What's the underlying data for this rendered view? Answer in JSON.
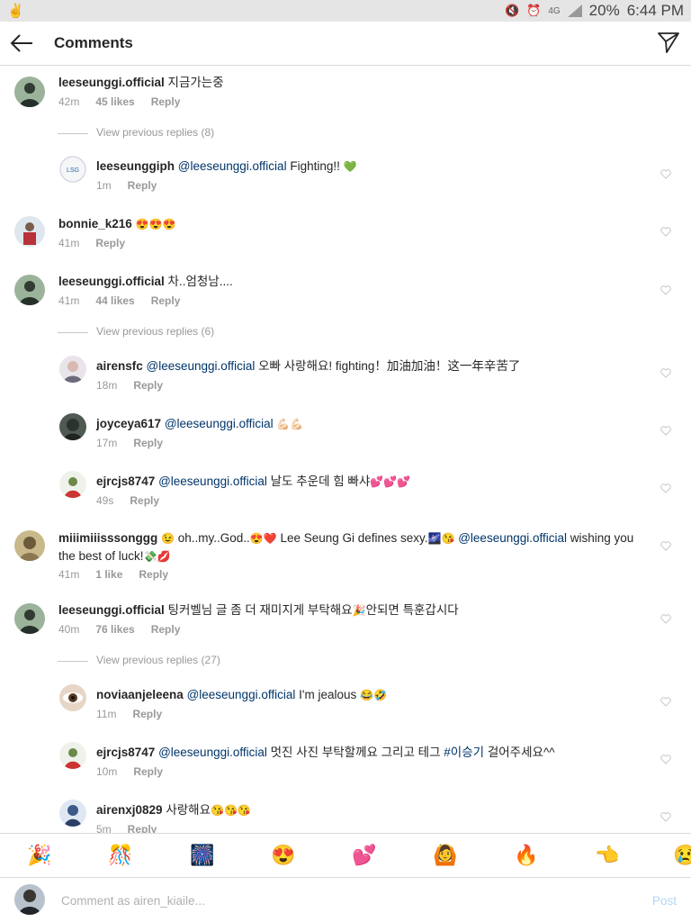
{
  "status": {
    "battery": "20%",
    "time": "6:44 PM",
    "network": "4G"
  },
  "header": {
    "title": "Comments"
  },
  "labels": {
    "reply": "Reply"
  },
  "comments": [
    {
      "user": "leeseunggi.official",
      "text": "지금가는중",
      "time": "42m",
      "likes": "45 likes"
    },
    {
      "view_prev": "View previous replies (8)"
    },
    {
      "user": "leeseunggiph",
      "mention": "@leeseunggi.official",
      "text": "Fighting!!",
      "emoji": "💚",
      "time": "1m"
    },
    {
      "user": "bonnie_k216",
      "emoji": "😍😍😍",
      "time": "41m"
    },
    {
      "user": "leeseunggi.official",
      "text": "차..엄청남....",
      "time": "41m",
      "likes": "44 likes"
    },
    {
      "view_prev": "View previous replies (6)"
    },
    {
      "user": "airensfc",
      "mention": "@leeseunggi.official",
      "text": "오빠 사랑해요! fighting！加油加油！这一年辛苦了",
      "time": "18m"
    },
    {
      "user": "joyceya617",
      "mention": "@leeseunggi.official",
      "emoji": "💪🏻💪🏻",
      "time": "17m"
    },
    {
      "user": "ejrcjs8747",
      "mention": "@leeseunggi.official",
      "text": "날도 추운데 힘 빠샤",
      "emoji": "💕💕💕",
      "time": "49s"
    },
    {
      "user": "miiimiiisssonggg",
      "emoji_pre": "😉",
      "text": "oh..my..God..",
      "emoji_mid": "😍❤️",
      "text2": "Lee Seung Gi defines sexy.",
      "emoji_mid2": "🌌😘",
      "mention": "@leeseunggi.official",
      "text3": "wishing you the best of luck!",
      "emoji_end": "💸💋",
      "time": "41m",
      "likes": "1 like"
    },
    {
      "user": "leeseunggi.official",
      "text": "팅커벨님 글 좀 더 재미지게 부탁해요",
      "emoji_mid": "🎉",
      "text2": "안되면 특훈갑시다",
      "time": "40m",
      "likes": "76 likes"
    },
    {
      "view_prev": "View previous replies (27)"
    },
    {
      "user": "noviaanjeleena",
      "mention": "@leeseunggi.official",
      "text": "I'm jealous",
      "emoji": "😂🤣",
      "time": "11m"
    },
    {
      "user": "ejrcjs8747",
      "mention": "@leeseunggi.official",
      "text": "멋진 사진 부탁할께요 그리고 테그",
      "hashtag": "#이승기",
      "text2": "걸어주세요^^",
      "time": "10m"
    },
    {
      "user": "airenxj0829",
      "text": "사랑해요",
      "emoji": "😘😘😘",
      "time": "5m"
    }
  ],
  "emoji_bar": [
    "🎉",
    "🎊",
    "🎆",
    "😍",
    "💕",
    "🙆",
    "🔥",
    "👈",
    "😢"
  ],
  "composer": {
    "placeholder": "Comment as airen_kiaile...",
    "post_label": "Post"
  },
  "colors": {
    "link": "#003569",
    "meta": "#999999",
    "divider": "#dbdbdb",
    "post": "#b3d7f5"
  }
}
